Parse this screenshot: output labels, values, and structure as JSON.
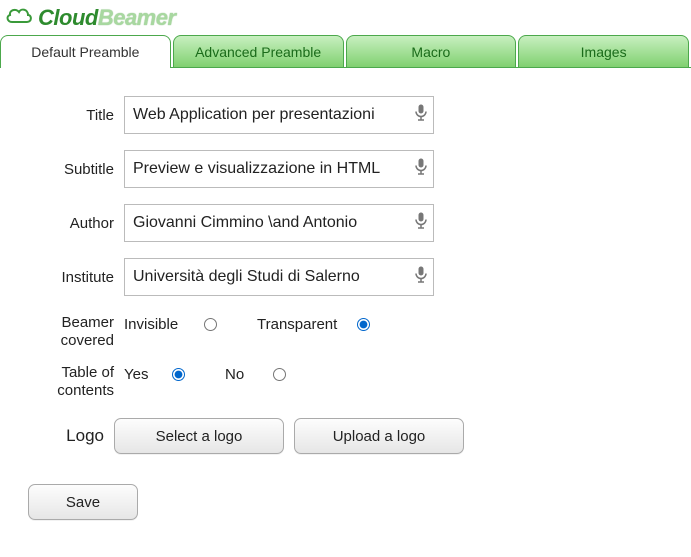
{
  "brand": {
    "word1": "Cloud",
    "word2": "Beamer"
  },
  "tabs": {
    "default": "Default Preamble",
    "advanced": "Advanced Preamble",
    "macro": "Macro",
    "images": "Images"
  },
  "form": {
    "title_label": "Title",
    "title_value": "Web Application per presentazioni",
    "subtitle_label": "Subtitle",
    "subtitle_value": "Preview e visualizzazione in HTML",
    "author_label": "Author",
    "author_value": "Giovanni Cimmino \\and Antonio",
    "institute_label": "Institute",
    "institute_value": "Università degli Studi di Salerno",
    "beamer_label": "Beamer covered",
    "beamer_opt1": "Invisible",
    "beamer_opt2": "Transparent",
    "beamer_selected": "transparent",
    "toc_label": "Table of contents",
    "toc_opt1": "Yes",
    "toc_opt2": "No",
    "toc_selected": "yes",
    "logo_label": "Logo",
    "select_logo": "Select a logo",
    "upload_logo": "Upload a logo",
    "save": "Save"
  }
}
